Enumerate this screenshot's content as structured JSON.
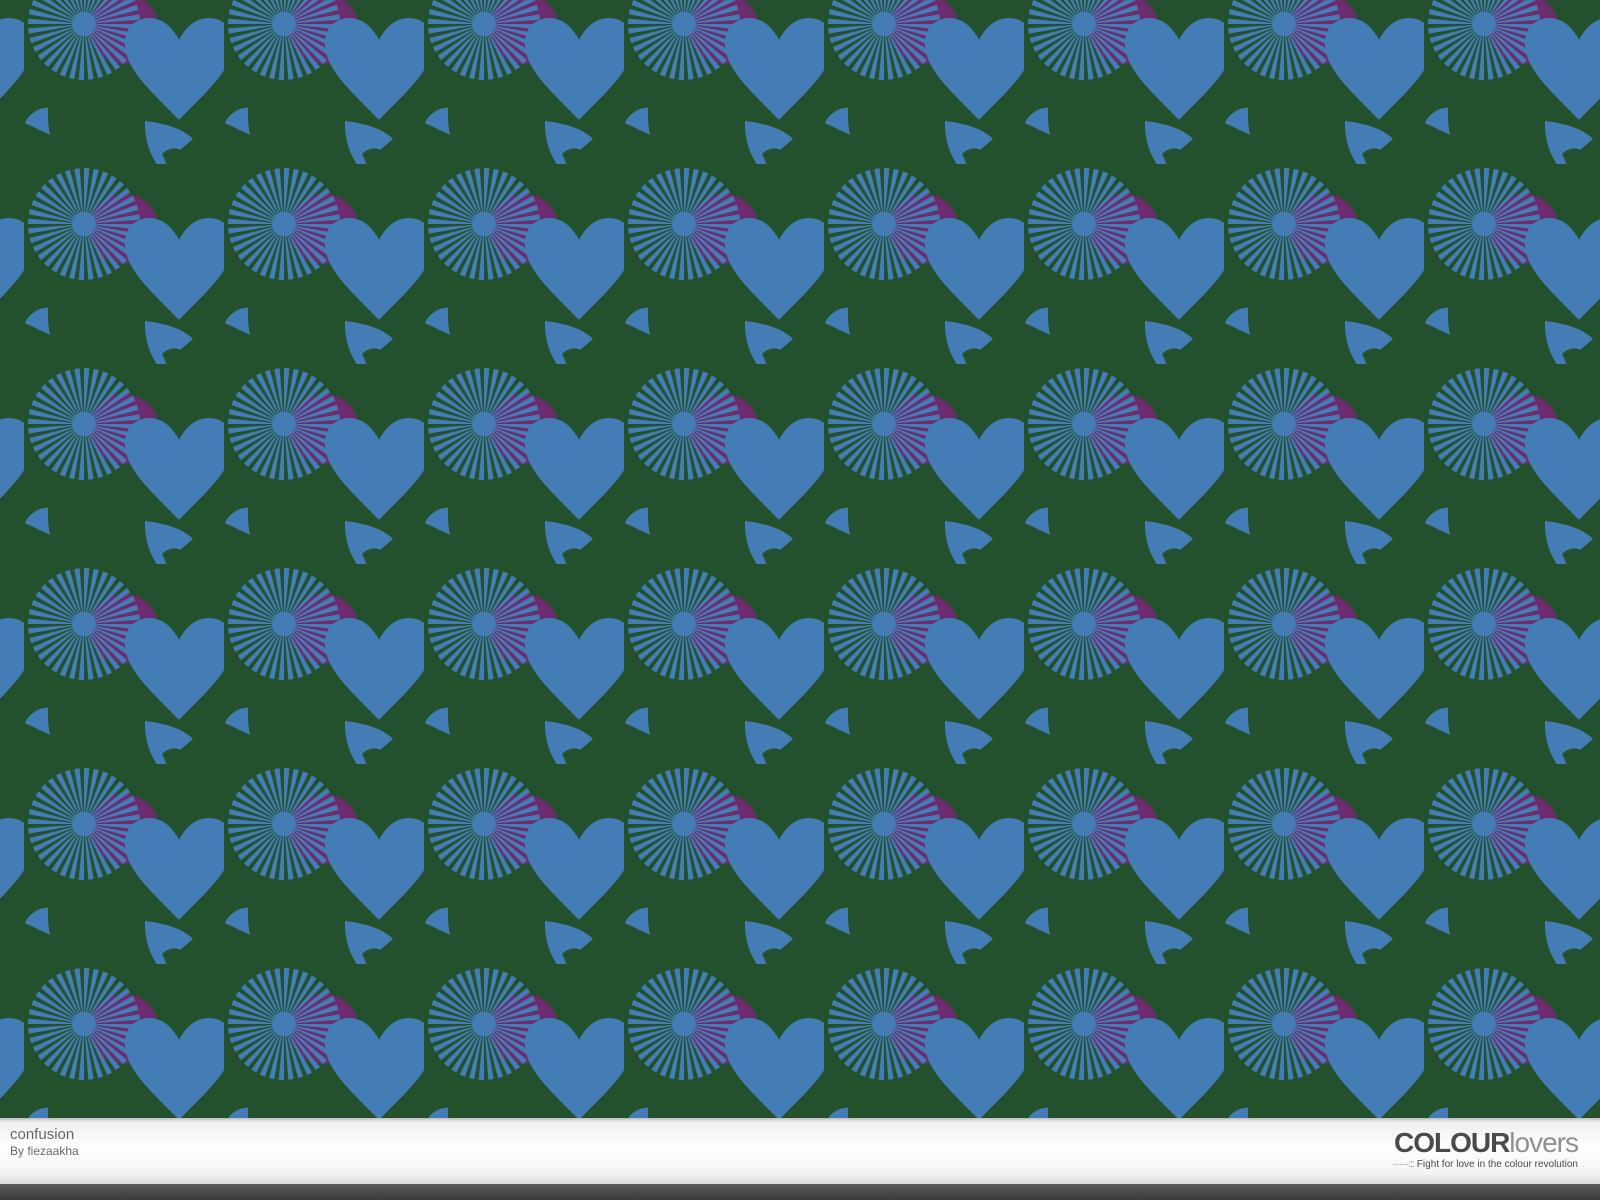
{
  "pattern": {
    "title": "confusion",
    "author": "By fiezaakha",
    "colors": {
      "background": "#23512D",
      "motif": "#447DB5",
      "accent": "#6C2C6E"
    }
  },
  "brand": {
    "name_bold": "COLOUR",
    "name_light": "lovers",
    "tagline": "Fight for love in the colour revolution"
  }
}
